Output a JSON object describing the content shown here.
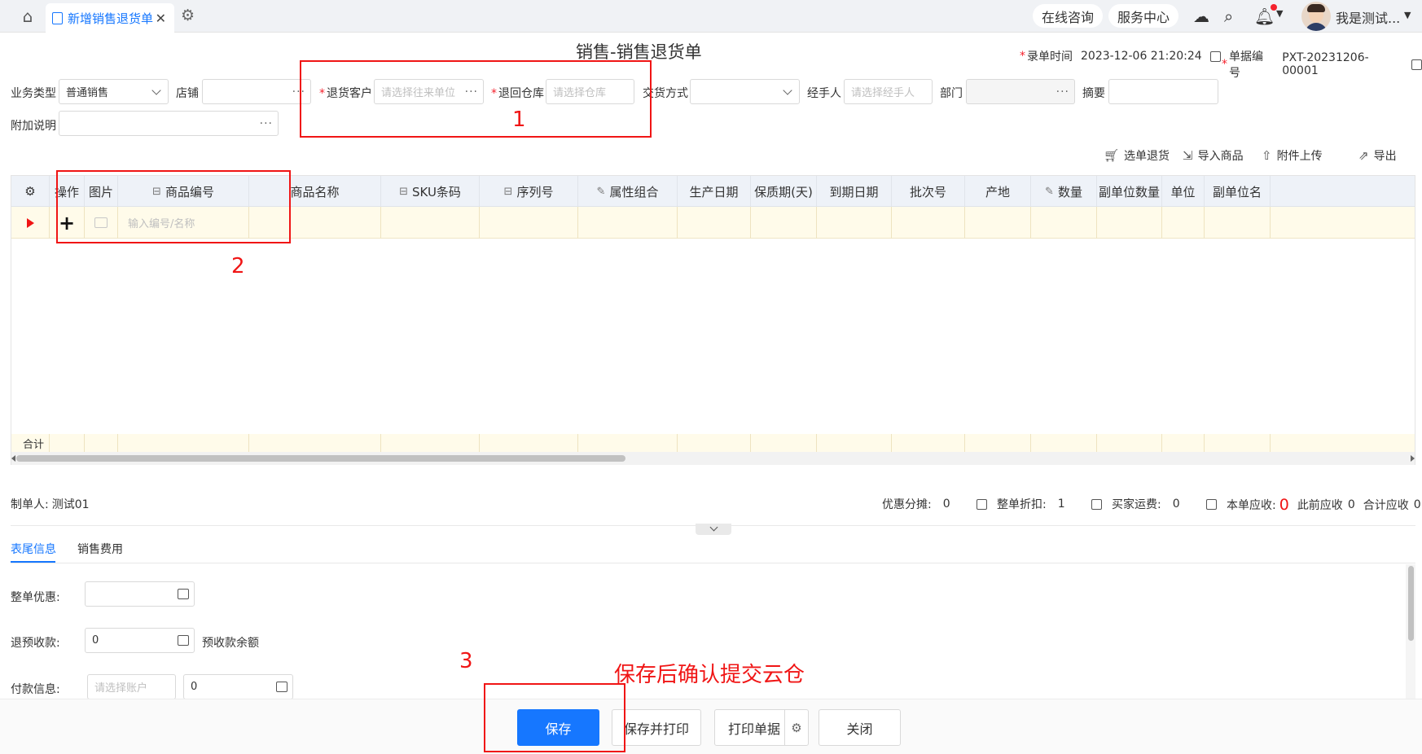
{
  "tabs": {
    "home_icon": "home-icon",
    "active_label": "新增销售退货单",
    "close": "✕"
  },
  "header": {
    "consult": "在线咨询",
    "service": "服务中心",
    "user_name": "我是测试..."
  },
  "page": {
    "title": "销售-销售退货单",
    "record_time_label": "录单时间",
    "record_time": "2023-12-06 21:20:24",
    "doc_no_label": "单据编号",
    "doc_no": "PXT-20231206-00001"
  },
  "form": {
    "biz_type_label": "业务类型",
    "biz_type_value": "普通销售",
    "shop_label": "店铺",
    "customer_label": "退货客户",
    "customer_placeholder": "请选择往来单位",
    "warehouse_label": "退回仓库",
    "warehouse_placeholder": "请选择仓库",
    "delivery_label": "交货方式",
    "handler_label": "经手人",
    "handler_placeholder": "请选择经手人",
    "dept_label": "部门",
    "summary_label": "摘要",
    "extra_label": "附加说明",
    "dots": "···"
  },
  "toolbar": {
    "select_return": "选单退货",
    "import_goods": "导入商品",
    "upload": "附件上传",
    "export": "导出"
  },
  "grid": {
    "columns": [
      "操作",
      "图片",
      "商品编号",
      "商品名称",
      "SKU条码",
      "序列号",
      "属性组合",
      "生产日期",
      "保质期(天)",
      "到期日期",
      "批次号",
      "产地",
      "数量",
      "副单位数量",
      "单位",
      "副单位名"
    ],
    "row_placeholder": "输入编号/名称",
    "plus": "+",
    "sum_label": "合计"
  },
  "summary": {
    "maker_label": "制单人:",
    "maker": "测试01",
    "discount_alloc_label": "优惠分摊:",
    "discount_alloc": "0",
    "whole_discount_label": "整单折扣:",
    "whole_discount": "1",
    "freight_label": "买家运费:",
    "freight": "0",
    "receivable_label": "本单应收:",
    "receivable": "0",
    "prev_receivable_label": "此前应收",
    "prev_receivable": "0",
    "total_receivable_label": "合计应收",
    "total_receivable": "0"
  },
  "bottom_tabs": {
    "tail_info": "表尾信息",
    "sales_cost": "销售费用"
  },
  "tail": {
    "whole_discount_label": "整单优惠:",
    "refund_prepay_label": "退预收款:",
    "refund_prepay_value": "0",
    "prepay_balance_label": "预收款余额",
    "payment_label": "付款信息:",
    "account_placeholder": "请选择账户",
    "payment_value": "0"
  },
  "buttons": {
    "save": "保存",
    "save_print": "保存并打印",
    "print_doc": "打印单据",
    "close": "关闭"
  },
  "annotations": {
    "n1": "1",
    "n2": "2",
    "n3": "3",
    "note": "保存后确认提交云仓"
  }
}
